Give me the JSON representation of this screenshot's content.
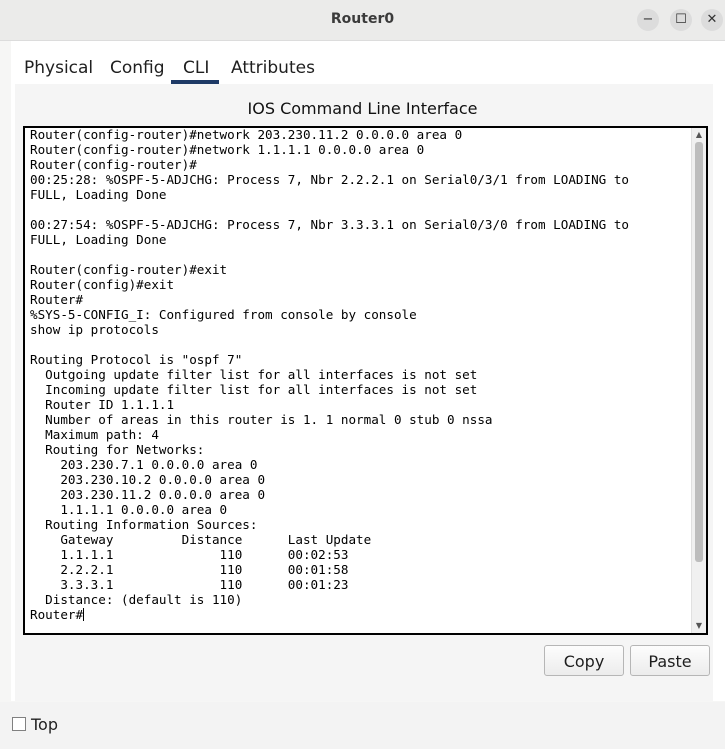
{
  "window": {
    "title": "Router0",
    "minimize_label": "−",
    "maximize_label": "☐",
    "close_label": "✕"
  },
  "tabs": [
    {
      "label": "Physical"
    },
    {
      "label": "Config"
    },
    {
      "label": "CLI"
    },
    {
      "label": "Attributes"
    }
  ],
  "active_tab": "CLI",
  "cli": {
    "heading": "IOS Command Line Interface",
    "output": "Router(config-router)#network 203.230.11.2 0.0.0.0 area 0\nRouter(config-router)#network 1.1.1.1 0.0.0.0 area 0\nRouter(config-router)#\n00:25:28: %OSPF-5-ADJCHG: Process 7, Nbr 2.2.2.1 on Serial0/3/1 from LOADING to\nFULL, Loading Done\n\n00:27:54: %OSPF-5-ADJCHG: Process 7, Nbr 3.3.3.1 on Serial0/3/0 from LOADING to\nFULL, Loading Done\n\nRouter(config-router)#exit\nRouter(config)#exit\nRouter#\n%SYS-5-CONFIG_I: Configured from console by console\nshow ip protocols\n\nRouting Protocol is \"ospf 7\"\n  Outgoing update filter list for all interfaces is not set\n  Incoming update filter list for all interfaces is not set\n  Router ID 1.1.1.1\n  Number of areas in this router is 1. 1 normal 0 stub 0 nssa\n  Maximum path: 4\n  Routing for Networks:\n    203.230.7.1 0.0.0.0 area 0\n    203.230.10.2 0.0.0.0 area 0\n    203.230.11.2 0.0.0.0 area 0\n    1.1.1.1 0.0.0.0 area 0\n  Routing Information Sources:\n    Gateway         Distance      Last Update\n    1.1.1.1              110      00:02:53\n    2.2.2.1              110      00:01:58\n    3.3.3.1              110      00:01:23\n  Distance: (default is 110)\n",
    "prompt": "Router#",
    "scroll_up_icon": "triangle-up",
    "scroll_down_icon": "triangle-down"
  },
  "buttons": {
    "copy_label": "Copy",
    "paste_label": "Paste"
  },
  "footer": {
    "top_label": "Top",
    "top_checked": false
  }
}
